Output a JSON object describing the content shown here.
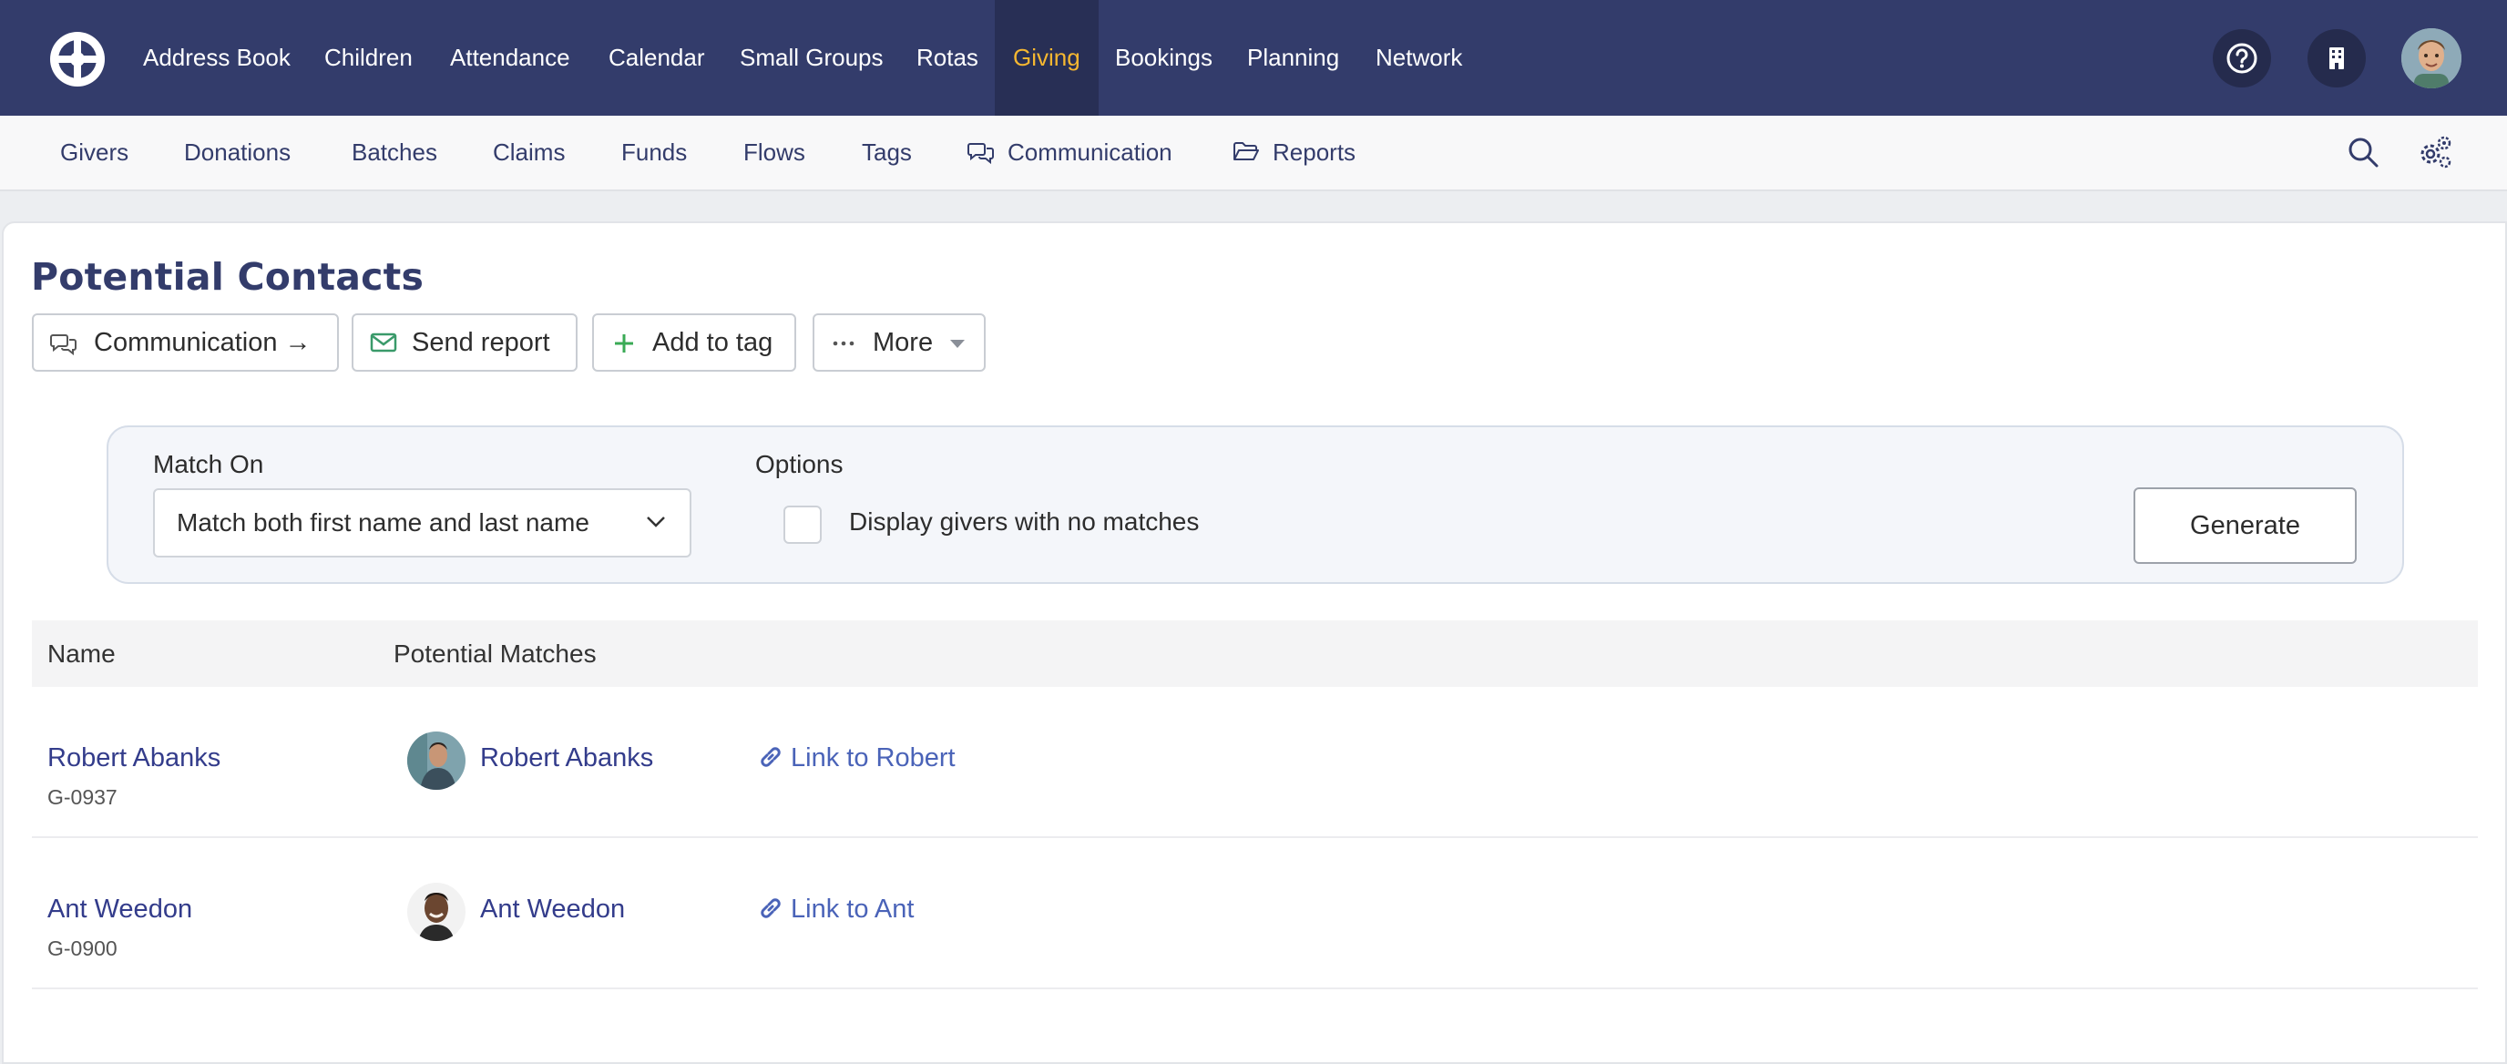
{
  "topnav": {
    "logo_icon": "wheel-logo-icon",
    "items": [
      {
        "label": "Address Book"
      },
      {
        "label": "Children"
      },
      {
        "label": "Attendance"
      },
      {
        "label": "Calendar"
      },
      {
        "label": "Small Groups"
      },
      {
        "label": "Rotas"
      },
      {
        "label": "Giving",
        "active": true
      },
      {
        "label": "Bookings"
      },
      {
        "label": "Planning"
      },
      {
        "label": "Network"
      }
    ],
    "right_icons": [
      "help-icon",
      "building-icon",
      "user-avatar"
    ],
    "accent_color": "#f5b731",
    "background_color": "#333c6b"
  },
  "subnav": {
    "items": [
      {
        "label": "Givers"
      },
      {
        "label": "Donations"
      },
      {
        "label": "Batches"
      },
      {
        "label": "Claims"
      },
      {
        "label": "Funds"
      },
      {
        "label": "Flows"
      },
      {
        "label": "Tags"
      },
      {
        "label": "Communication",
        "icon": "chat-icon"
      },
      {
        "label": "Reports",
        "icon": "folder-icon"
      }
    ],
    "right_icons": [
      "search-icon",
      "settings-icon"
    ]
  },
  "page": {
    "title": "Potential Contacts",
    "actions": [
      {
        "label": "Communication →",
        "icon": "chat-icon"
      },
      {
        "label": "Send report",
        "icon": "envelope-icon"
      },
      {
        "label": "Add to tag",
        "icon": "plus-icon"
      },
      {
        "label": "More",
        "icon": "ellipsis-icon"
      }
    ]
  },
  "filter": {
    "match_on_label": "Match On",
    "match_on_value": "Match both first name and last name",
    "options_label": "Options",
    "checkbox_label": "Display givers with no matches",
    "checkbox_checked": false,
    "generate_label": "Generate"
  },
  "table": {
    "columns": [
      "Name",
      "Potential Matches"
    ],
    "rows": [
      {
        "name": "Robert Abanks",
        "code": "G-0937",
        "match_name": "Robert Abanks",
        "link_label": "Link to Robert"
      },
      {
        "name": "Ant Weedon",
        "code": "G-0900",
        "match_name": "Ant Weedon",
        "link_label": "Link to Ant"
      }
    ]
  }
}
